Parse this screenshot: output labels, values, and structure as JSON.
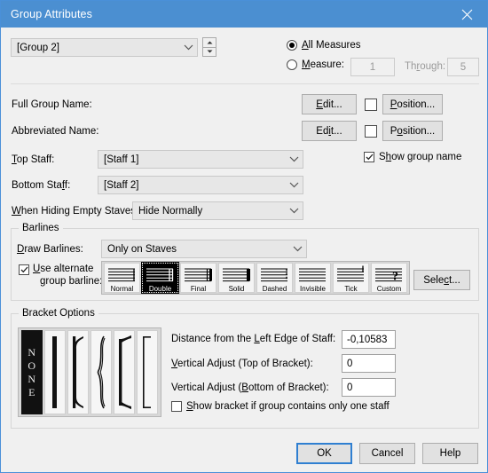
{
  "window": {
    "title": "Group Attributes",
    "close_icon": "close-icon"
  },
  "group_selector": {
    "value": "[Group 2]",
    "spinner_up_icon": "spinner-up-icon",
    "spinner_down_icon": "spinner-down-icon"
  },
  "measures": {
    "all_measures_label": "All Measures",
    "all_measures_selected": true,
    "measure_label": "Measure:",
    "measure_value": "1",
    "through_label": "Through:",
    "through_value": "5"
  },
  "names": {
    "full_group_name_label": "Full Group Name:",
    "full_group_name_edit": "Edit...",
    "full_group_name_position": "Position...",
    "abbreviated_name_label": "Abbreviated Name:",
    "abbreviated_name_edit": "Edit...",
    "abbreviated_name_position": "Position...",
    "show_group_name_label": "Show group name",
    "show_group_name_checked": true
  },
  "staves": {
    "top_staff_label": "Top Staff:",
    "top_staff_value": "[Staff 1]",
    "bottom_staff_label": "Bottom Staff:",
    "bottom_staff_value": "[Staff 2]",
    "hiding_label": "When Hiding Empty Staves:",
    "hiding_value": "Hide Normally"
  },
  "barlines": {
    "group_title": "Barlines",
    "draw_barlines_label": "Draw Barlines:",
    "draw_barlines_value": "Only on Staves",
    "use_alternate_label_line1": "Use alternate",
    "use_alternate_label_line2": "group barline:",
    "use_alternate_checked": true,
    "select_button": "Select...",
    "styles": [
      {
        "name": "Normal",
        "selected": false
      },
      {
        "name": "Double",
        "selected": true
      },
      {
        "name": "Final",
        "selected": false
      },
      {
        "name": "Solid",
        "selected": false
      },
      {
        "name": "Dashed",
        "selected": false
      },
      {
        "name": "Invisible",
        "selected": false
      },
      {
        "name": "Tick",
        "selected": false
      },
      {
        "name": "Custom",
        "selected": false
      }
    ]
  },
  "bracket": {
    "group_title": "Bracket Options",
    "styles": [
      {
        "name": "none",
        "selected": true
      },
      {
        "name": "thick-line",
        "selected": false
      },
      {
        "name": "bracket",
        "selected": false
      },
      {
        "name": "brace",
        "selected": false
      },
      {
        "name": "piano-bracket",
        "selected": false
      },
      {
        "name": "thin-bracket",
        "selected": false
      }
    ],
    "none_letters": "N O N E",
    "distance_label": "Distance from the Left Edge of Staff:",
    "distance_value": "-0,10583",
    "vadjust_top_label": "Vertical Adjust (Top of Bracket):",
    "vadjust_top_value": "0",
    "vadjust_bottom_label": "Vertical Adjust (Bottom of Bracket):",
    "vadjust_bottom_value": "0",
    "show_one_staff_label": "Show bracket if group contains only one staff",
    "show_one_staff_checked": false
  },
  "footer": {
    "ok": "OK",
    "cancel": "Cancel",
    "help": "Help"
  },
  "colors": {
    "titlebar": "#4b8fd1",
    "dialog_bg": "#f0f0f0",
    "accent_border": "#4a90d9"
  }
}
